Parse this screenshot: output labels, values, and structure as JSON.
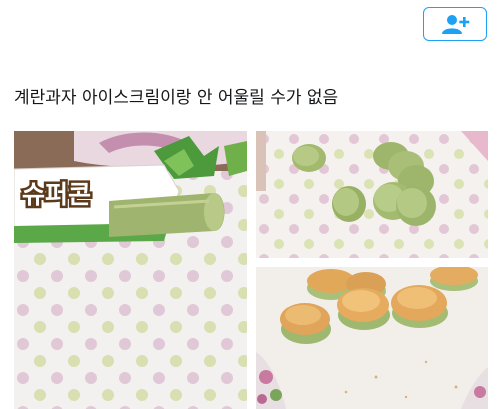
{
  "tweet": {
    "text": "계란과자 아이스크림이랑 안 어울릴 수가 없음"
  },
  "follow_button": {
    "icon": "person-plus-icon",
    "color": "#1da1f2"
  },
  "photos": {
    "photo1": {
      "packaging_text": "슈퍼콘"
    }
  }
}
